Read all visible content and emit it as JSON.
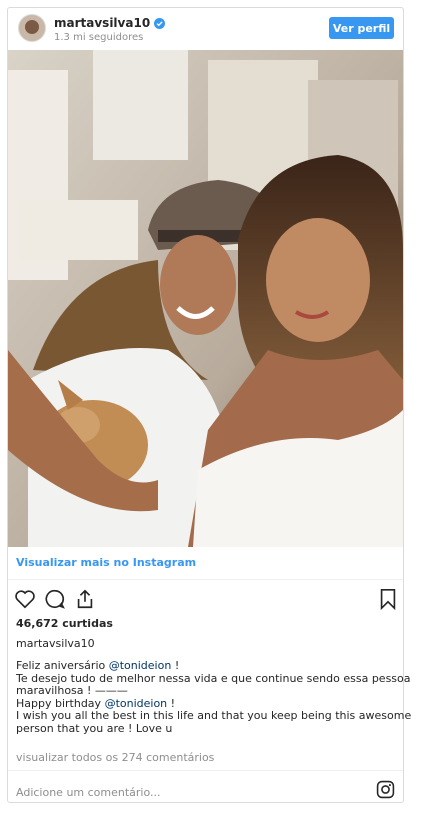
{
  "header": {
    "username": "martavsilva10",
    "followers": "1.3 mi seguidores",
    "view_profile_label": "Ver perfil"
  },
  "post": {
    "view_more_label": "Visualizar mais no Instagram",
    "likes": "46,672 curtidas",
    "author": "martavsilva10",
    "caption": {
      "line1_prefix": "Feliz aniversário ",
      "line1_mention": "@tonideion",
      "line1_suffix": " !",
      "line2": "Te desejo tudo de melhor nessa vida e que continue sendo essa pessoa",
      "line3": "maravilhosa ! ———",
      "line4_prefix": "Happy birthday ",
      "line4_mention": "@tonideion",
      "line4_suffix": " !",
      "line5": "I wish you all the best in this life and that you keep being this awesome",
      "line6": "person that you are ! Love u"
    },
    "comments_link": "visualizar todos os 274 comentários",
    "comment_placeholder": "Adicione um comentário..."
  },
  "icons": [
    "verified-badge-icon",
    "heart-icon",
    "comment-icon",
    "share-icon",
    "bookmark-icon",
    "instagram-icon"
  ],
  "colors": {
    "accent": "#3897f0",
    "mention": "#003569",
    "muted": "#8e8e8e"
  }
}
